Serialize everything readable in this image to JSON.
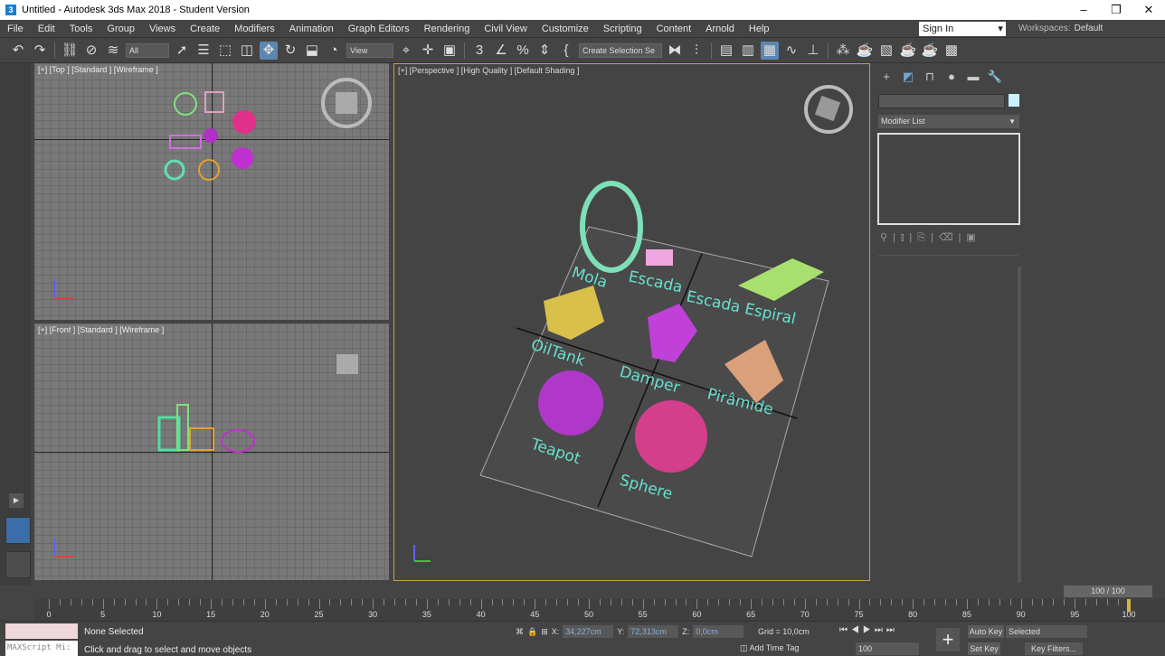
{
  "window": {
    "title": "Untitled - Autodesk 3ds Max 2018 - Student Version",
    "app_icon_letter": "3",
    "controls": [
      "–",
      "❐",
      "✕"
    ]
  },
  "menu": [
    "File",
    "Edit",
    "Tools",
    "Group",
    "Views",
    "Create",
    "Modifiers",
    "Animation",
    "Graph Editors",
    "Rendering",
    "Civil View",
    "Customize",
    "Scripting",
    "Content",
    "Arnold",
    "Help"
  ],
  "account": {
    "signin": "Sign In",
    "workspaces_label": "Workspaces:",
    "workspace": "Default"
  },
  "toolbar": {
    "filter": "All",
    "ref_coord": "View",
    "named_selection": "Create Selection Se"
  },
  "viewports": {
    "top_label": "[+] [Top ] [Standard ] [Wireframe ]",
    "front_label": "[+] [Front ] [Standard ] [Wireframe ]",
    "persp_label": "[+] [Perspective ] [High Quality ] [Default Shading ]"
  },
  "scene_labels": [
    "Mola",
    "Escada",
    "Escada Espiral",
    "OilTank",
    "Damper",
    "Pirâmide",
    "Teapot",
    "Sphere"
  ],
  "command_panel": {
    "modifier_list": "Modifier List"
  },
  "timeline": {
    "counter": "100 / 100",
    "ticks": [
      "0",
      "5",
      "10",
      "15",
      "20",
      "25",
      "30",
      "35",
      "40",
      "45",
      "50",
      "55",
      "60",
      "65",
      "70",
      "75",
      "80",
      "85",
      "90",
      "95",
      "100"
    ],
    "current_frame": 100
  },
  "status": {
    "selection": "None Selected",
    "prompt": "Click and drag to select and move objects",
    "maxscript": "MAXScript Mi:",
    "x_label": "X:",
    "x": "34,227cm",
    "y_label": "Y:",
    "y": "72,313cm",
    "z_label": "Z:",
    "z": "0,0cm",
    "grid": "Grid = 10,0cm",
    "add_time_tag": "Add Time Tag",
    "frame": "100",
    "auto_key": "Auto Key",
    "set_key": "Set Key",
    "key_mode": "Selected",
    "key_filters": "Key Filters..."
  }
}
